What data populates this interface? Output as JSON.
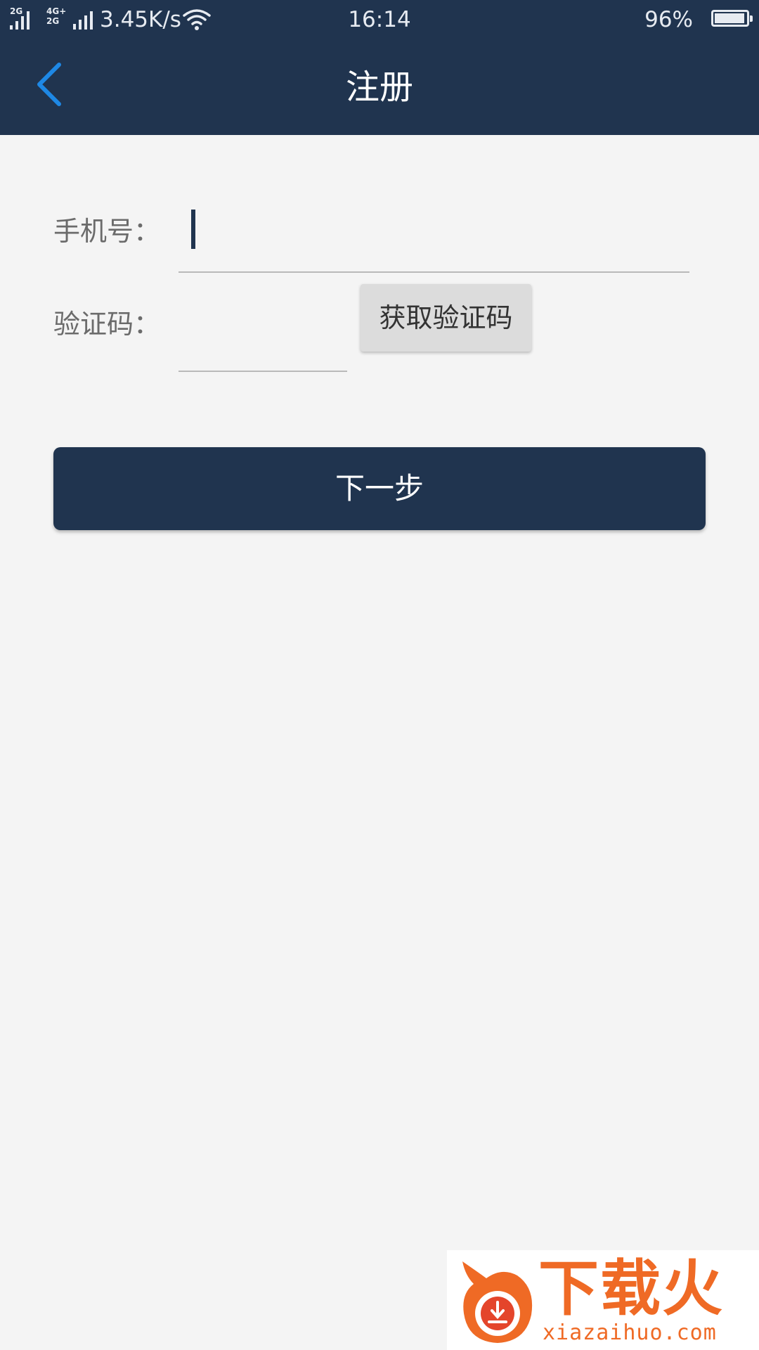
{
  "status_bar": {
    "signal1_label": "2G",
    "signal2_label_top": "4G+",
    "signal2_label_bottom": "2G",
    "network_speed": "3.45K/s",
    "time": "16:14",
    "battery_percent": "96%",
    "battery_level": 0.96
  },
  "header": {
    "title": "注册",
    "back_icon": "chevron-left-icon",
    "back_icon_color": "#1e88e5"
  },
  "form": {
    "phone_label": "手机号：",
    "phone_value": "",
    "code_label": "验证码：",
    "code_value": "",
    "get_code_button": "获取验证码",
    "next_button": "下一步"
  },
  "watermark": {
    "brand": "下载火",
    "url": "xiazaihuo.com"
  },
  "colors": {
    "primary": "#20344f",
    "background": "#f4f4f4",
    "accent_blue": "#1e88e5",
    "watermark_orange": "#ef6a25"
  }
}
